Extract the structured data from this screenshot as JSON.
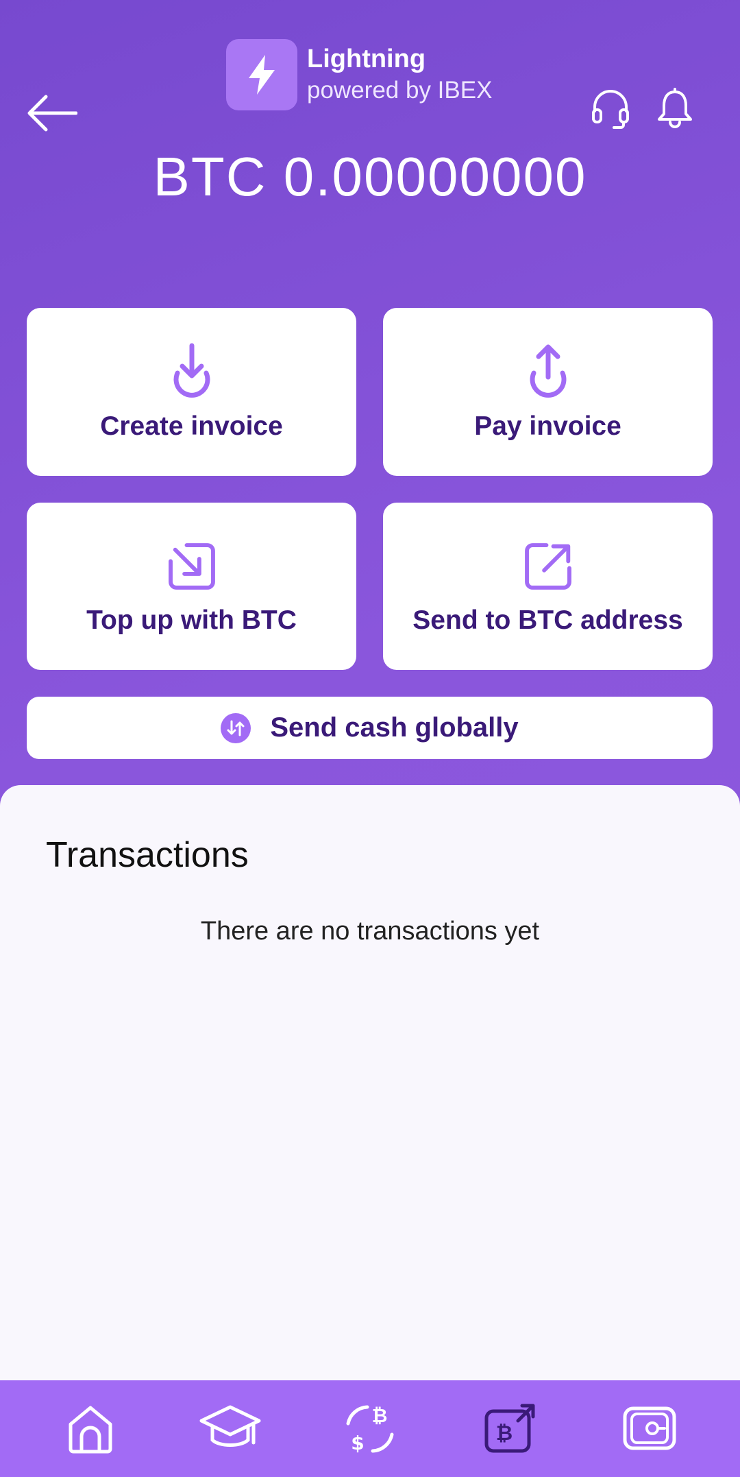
{
  "header": {
    "brand_title": "Lightning",
    "brand_subtitle": "powered by IBEX",
    "icons": [
      "back-arrow-icon",
      "lightning-bolt-icon",
      "headset-icon",
      "bell-icon"
    ]
  },
  "balance": "BTC 0.00000000",
  "actions": {
    "create_invoice": "Create invoice",
    "pay_invoice": "Pay invoice",
    "top_up": "Top up with BTC",
    "send_address": "Send to BTC address",
    "send_cash": "Send cash globally"
  },
  "transactions": {
    "title": "Transactions",
    "empty_text": "There are no transactions yet"
  },
  "nav": {
    "icons": [
      "home-icon",
      "graduation-cap-icon",
      "bitcoin-exchange-icon",
      "bitcoin-wallet-icon",
      "vault-icon"
    ]
  },
  "colors": {
    "background": "#8552d8",
    "accent": "#a26bf5",
    "card_text": "#3a1a78",
    "icon_purple": "#a26bf5"
  }
}
